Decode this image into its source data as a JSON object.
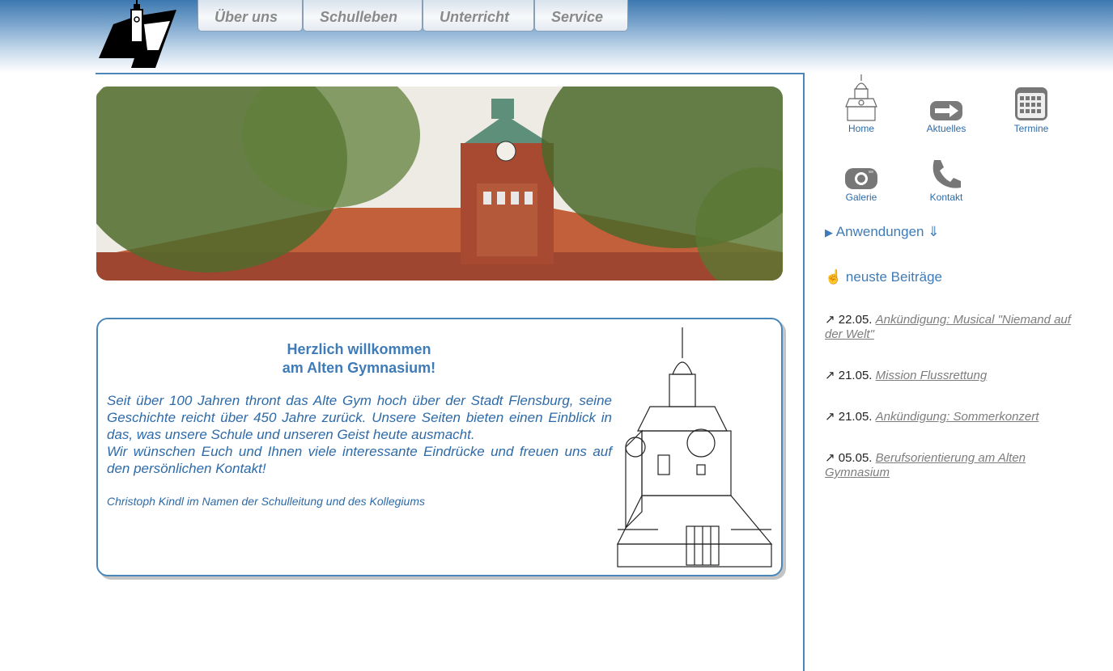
{
  "nav": {
    "items": [
      "Über uns",
      "Schulleben",
      "Unterricht",
      "Service"
    ]
  },
  "sidebar": {
    "icons": [
      {
        "label": "Home",
        "icon": "school-tower-icon"
      },
      {
        "label": "Aktuelles",
        "icon": "arrow-sign-icon"
      },
      {
        "label": "Termine",
        "icon": "calendar-icon"
      },
      {
        "label": "Galerie",
        "icon": "camera-icon"
      },
      {
        "label": "Kontakt",
        "icon": "phone-icon"
      }
    ],
    "apps": {
      "arrow": "▶",
      "label": "Anwendungen ⇓"
    },
    "posts_header": {
      "hand": "☝",
      "label": "neuste Beiträge"
    },
    "posts": [
      {
        "arrow": "↗",
        "date": "22.05.",
        "title": "Ankündigung: Musical \"Niemand auf der Welt\""
      },
      {
        "arrow": "↗",
        "date": "21.05.",
        "title": "Mission Flussrettung"
      },
      {
        "arrow": "↗",
        "date": "21.05.",
        "title": "Ankündigung: Sommerkonzert"
      },
      {
        "arrow": "↗",
        "date": "05.05.",
        "title": "Berufsorientierung am Alten Gymnasium"
      }
    ]
  },
  "welcome": {
    "title_line1": "Herzlich willkommen",
    "title_line2": "am Alten Gymnasium!",
    "paragraph1": "Seit über 100 Jahren thront das Alte Gym hoch über der Stadt Flensburg, seine Geschichte reicht über 450 Jahre zurück. Unsere Seiten bieten einen Einblick in das, was unsere Schule und unseren Geist heute ausmacht.",
    "paragraph2": "Wir wünschen Euch und Ihnen viele interessante Eindrücke und freuen uns auf den persönlichen Kontakt!",
    "signature": "Christoph Kindl im Namen der Schulleitung und des Kollegiums"
  },
  "colors": {
    "accent": "#3f7bb8",
    "frame": "#4b86b8",
    "link": "#7d7d7d"
  }
}
